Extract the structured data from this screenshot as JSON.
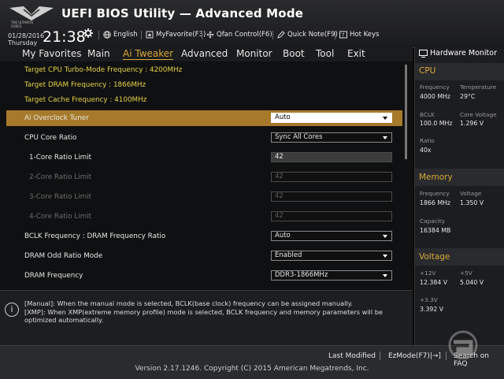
{
  "header": {
    "logo_text": "THE ULTIMATE FORCE",
    "title": "UEFI BIOS Utility — Advanced Mode",
    "date": "01/28/2016",
    "day": "Thursday",
    "time": "21:38",
    "items": [
      {
        "label": "English",
        "icon": "globe-icon"
      },
      {
        "label": "MyFavorite(F3)",
        "icon": "favorite-icon"
      },
      {
        "label": "Qfan Control(F6)",
        "icon": "fan-icon"
      },
      {
        "label": "Quick Note(F9)",
        "icon": "note-icon"
      },
      {
        "label": "Hot Keys",
        "icon": "hotkeys-icon"
      }
    ]
  },
  "tabs": [
    "My Favorites",
    "Main",
    "Ai Tweaker",
    "Advanced",
    "Monitor",
    "Boot",
    "Tool",
    "Exit"
  ],
  "active_tab": "Ai Tweaker",
  "info_lines": [
    "Target CPU Turbo-Mode Frequency : 4200MHz",
    "Target DRAM Frequency : 1866MHz",
    "Target Cache Frequency : 4100MHz"
  ],
  "settings": [
    {
      "label": "Ai Overclock Tuner",
      "value": "Auto",
      "kind": "select",
      "highlight": true
    },
    {
      "label": "CPU Core Ratio",
      "value": "Sync All Cores",
      "kind": "select"
    },
    {
      "label": "1-Core Ratio Limit",
      "value": "42",
      "kind": "number"
    },
    {
      "label": "2-Core Ratio Limit",
      "value": "42",
      "kind": "disabled"
    },
    {
      "label": "3-Core Ratio Limit",
      "value": "42",
      "kind": "disabled"
    },
    {
      "label": "4-Core Ratio Limit",
      "value": "42",
      "kind": "disabled"
    },
    {
      "label": "BCLK Frequency : DRAM Frequency Ratio",
      "value": "Auto",
      "kind": "select"
    },
    {
      "label": "DRAM Odd Ratio Mode",
      "value": "Enabled",
      "kind": "select"
    },
    {
      "label": "DRAM Frequency",
      "value": "DDR3-1866MHz",
      "kind": "select"
    }
  ],
  "help": {
    "lines": [
      "[Manual]: When the manual mode is selected, BCLK(base clock) frequency can be assigned manually.",
      "[XMP]: When XMP(extreme memory profile) mode is selected, BCLK frequency and memory parameters will be optimized automatically."
    ]
  },
  "hw": {
    "title": "Hardware Monitor",
    "cpu": {
      "title": "CPU",
      "frequency_label": "Frequency",
      "frequency": "4000 MHz",
      "temperature_label": "Temperature",
      "temperature": "29°C",
      "bclk_label": "BCLK",
      "bclk": "100.0 MHz",
      "core_voltage_label": "Core Voltage",
      "core_voltage": "1.296 V",
      "ratio_label": "Ratio",
      "ratio": "40x"
    },
    "memory": {
      "title": "Memory",
      "frequency_label": "Frequency",
      "frequency": "1866 MHz",
      "voltage_label": "Voltage",
      "voltage": "1.350 V",
      "capacity_label": "Capacity",
      "capacity": "16384 MB"
    },
    "voltage": {
      "title": "Voltage",
      "v12_label": "+12V",
      "v12": "12.384 V",
      "v5_label": "+5V",
      "v5": "5.040 V",
      "v33_label": "+3.3V",
      "v33": "3.392 V"
    }
  },
  "footer": {
    "last_modified": "Last Modified",
    "ezmode": "EzMode(F7)|→]",
    "search": "Search on FAQ",
    "copyright": "Version 2.17.1246. Copyright (C) 2015 American Megatrends, Inc."
  },
  "colors": {
    "accent": "#d9a93a",
    "info": "#e8d34a",
    "highlight": "#a67a2a"
  }
}
